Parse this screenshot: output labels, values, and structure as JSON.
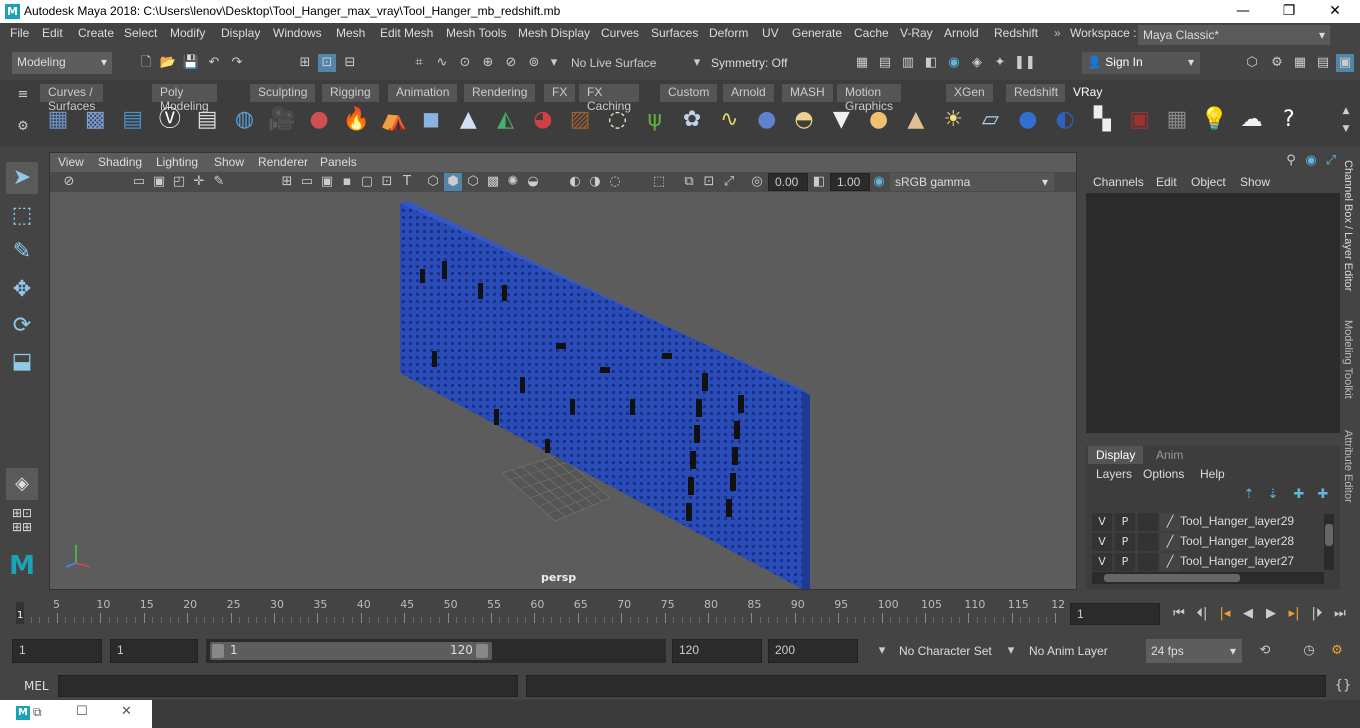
{
  "window": {
    "title": "Autodesk Maya 2018: C:\\Users\\lenov\\Desktop\\Tool_Hanger_max_vray\\Tool_Hanger_mb_redshift.mb",
    "logo": "M"
  },
  "menubar": {
    "items": [
      "File",
      "Edit",
      "Create",
      "Select",
      "Modify",
      "Display",
      "Windows",
      "Mesh",
      "Edit Mesh",
      "Mesh Tools",
      "Mesh Display",
      "Curves",
      "Surfaces",
      "Deform",
      "UV",
      "Generate",
      "Cache",
      "V-Ray",
      "Arnold",
      "Redshift"
    ],
    "workspace_label": "Workspace :",
    "workspace_value": "Maya Classic*"
  },
  "statusline": {
    "mode": "Modeling",
    "live_surface": "No Live Surface",
    "symmetry": "Symmetry: Off",
    "sign_in": "Sign In"
  },
  "shelf": {
    "tabs": [
      "Curves / Surfaces",
      "Poly Modeling",
      "Sculpting",
      "Rigging",
      "Animation",
      "Rendering",
      "FX",
      "FX Caching",
      "Custom",
      "Arnold",
      "MASH",
      "Motion Graphics",
      "XGen",
      "Redshift",
      "VRay"
    ],
    "active_tab": "VRay",
    "icon_names": [
      "grid-icon",
      "quilt-icon",
      "stack-icon",
      "vray-logo-icon",
      "document-icon",
      "sphere-globe-icon",
      "camera-icon",
      "spheres-icon",
      "fire-icon",
      "tent-icon",
      "cube-light-icon",
      "cone-icon",
      "rainbow-light-icon",
      "lathe-icon",
      "crate-icon",
      "wire-sphere-icon",
      "grass-icon",
      "fur-ball-icon",
      "curve-icon",
      "sphere-blue-icon",
      "dome-light-icon",
      "spot-light-icon",
      "sun-glow-icon",
      "cone-light-icon",
      "sun-icon",
      "plane-icon",
      "shiny-sphere-icon",
      "flag-sphere-icon",
      "checker-icon",
      "render-view-icon",
      "frame-buffer-icon",
      "light-lister-icon",
      "cloud-icon",
      "help-icon"
    ]
  },
  "viewport": {
    "menu": [
      "View",
      "Shading",
      "Lighting",
      "Show",
      "Renderer",
      "Panels"
    ],
    "exposure": "0.00",
    "gamma": "1.00",
    "color_space": "sRGB gamma",
    "camera_label": "persp"
  },
  "channel_box": {
    "menu": [
      "Channels",
      "Edit",
      "Object",
      "Show"
    ],
    "tabs": [
      "Display",
      "Anim"
    ],
    "layer_menu": [
      "Layers",
      "Options",
      "Help"
    ],
    "layers": [
      {
        "v": "V",
        "p": "P",
        "name": "Tool_Hanger_layer29"
      },
      {
        "v": "V",
        "p": "P",
        "name": "Tool_Hanger_layer28"
      },
      {
        "v": "V",
        "p": "P",
        "name": "Tool_Hanger_layer27"
      }
    ]
  },
  "side_tabs": [
    "Channel Box / Layer Editor",
    "Modeling Toolkit",
    "Attribute Editor"
  ],
  "timeslider": {
    "ticks": [
      "5",
      "10",
      "15",
      "20",
      "25",
      "30",
      "35",
      "40",
      "45",
      "50",
      "55",
      "60",
      "65",
      "70",
      "75",
      "80",
      "85",
      "90",
      "95",
      "100",
      "105",
      "110",
      "115",
      "12"
    ],
    "current_marker": "1",
    "current_frame": "1"
  },
  "range": {
    "start": "1",
    "playback_start": "1",
    "slider_start": "1",
    "slider_end": "120",
    "playback_end": "120",
    "end": "200",
    "character_set": "No Character Set",
    "anim_layer": "No Anim Layer",
    "fps": "24 fps"
  },
  "cmdline": {
    "label": "MEL"
  }
}
